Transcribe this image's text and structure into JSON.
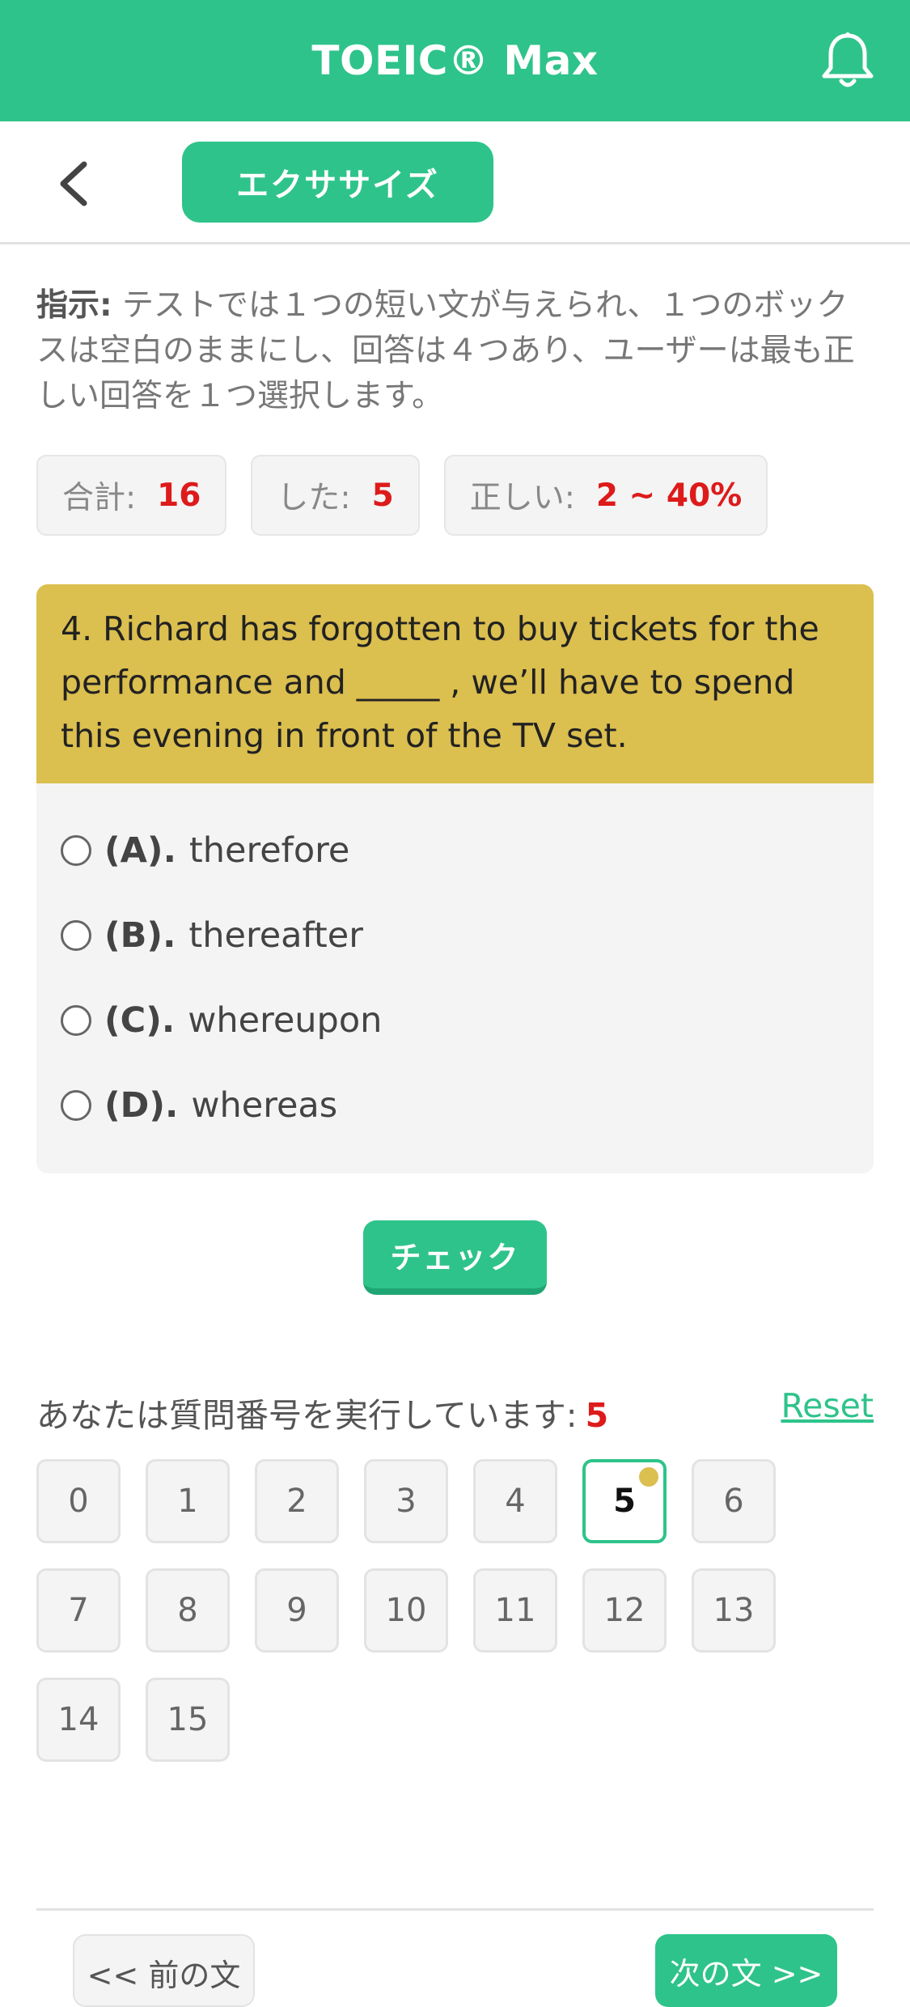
{
  "header": {
    "title": "TOEIC® Max",
    "bell_icon": "bell-icon"
  },
  "nav": {
    "back_icon": "chevron-left-icon",
    "tab_label": "エクササイズ"
  },
  "instructions": {
    "label": "指示:",
    "text": " テストでは１つの短い文が与えられ、１つのボックスは空白のままにし、回答は４つあり、ユーザーは最も正しい回答を１つ選択します。"
  },
  "stats": {
    "total_label": "合計:",
    "total_value": "16",
    "done_label": "した:",
    "done_value": "5",
    "correct_label": "正しい:",
    "correct_value": "2 ~ 40%"
  },
  "question": {
    "text": "4. Richard has forgotten to buy tickets for the performance and _____ , we’ll have to spend this evening in front of the TV set.",
    "options": [
      {
        "key": "(A).",
        "text": "therefore"
      },
      {
        "key": "(B).",
        "text": "thereafter"
      },
      {
        "key": "(C).",
        "text": "whereupon"
      },
      {
        "key": "(D).",
        "text": "whereas"
      }
    ]
  },
  "check_button": "チェック",
  "progress": {
    "label": "あなたは質問番号を実行しています:",
    "current": "5",
    "reset": "Reset",
    "numbers": [
      "0",
      "1",
      "2",
      "3",
      "4",
      "5",
      "6",
      "7",
      "8",
      "9",
      "10",
      "11",
      "12",
      "13",
      "14",
      "15"
    ]
  },
  "footer": {
    "prev": "<< 前の文",
    "next": "次の文 >>"
  },
  "colors": {
    "accent": "#2ec38a",
    "question_bg": "#dbbf4f",
    "highlight": "#dd1b1b"
  }
}
